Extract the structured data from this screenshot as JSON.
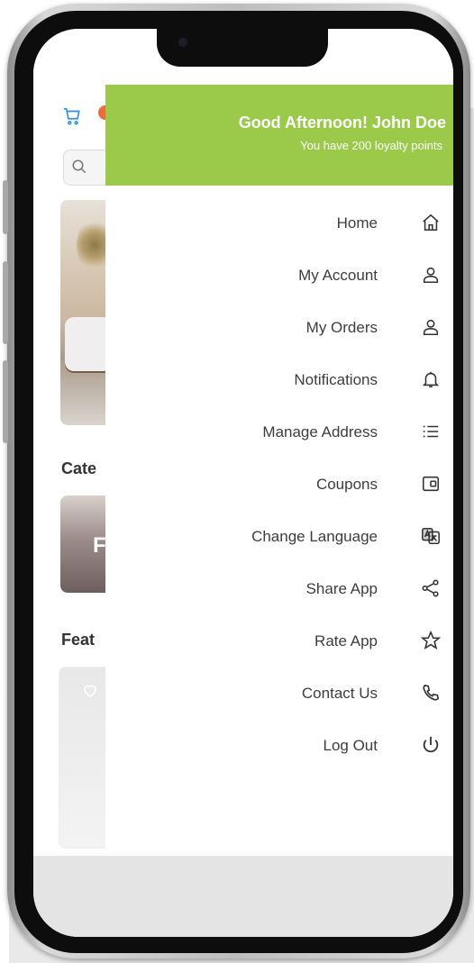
{
  "drawer": {
    "greeting": "Good Afternoon! John Doe",
    "points_text": "You have 200 loyalty points",
    "header_color": "#9bc94a"
  },
  "menu": [
    {
      "label": "Home",
      "icon": "home-icon"
    },
    {
      "label": "My Account",
      "icon": "user-icon"
    },
    {
      "label": "My Orders",
      "icon": "user-icon"
    },
    {
      "label": "Notifications",
      "icon": "bell-icon"
    },
    {
      "label": "Manage Address",
      "icon": "list-icon"
    },
    {
      "label": "Coupons",
      "icon": "wallet-icon"
    },
    {
      "label": "Change Language",
      "icon": "translate-icon"
    },
    {
      "label": "Share App",
      "icon": "share-icon"
    },
    {
      "label": "Rate App",
      "icon": "star-icon"
    },
    {
      "label": "Contact Us",
      "icon": "phone-icon"
    },
    {
      "label": "Log Out",
      "icon": "power-icon"
    }
  ],
  "background_app": {
    "categories_heading": "Cate",
    "featured_heading": "Feat",
    "category_letter": "F",
    "cart_icon": "cart-icon",
    "search_icon": "search-icon",
    "accent_color": "#2f8fe6"
  }
}
